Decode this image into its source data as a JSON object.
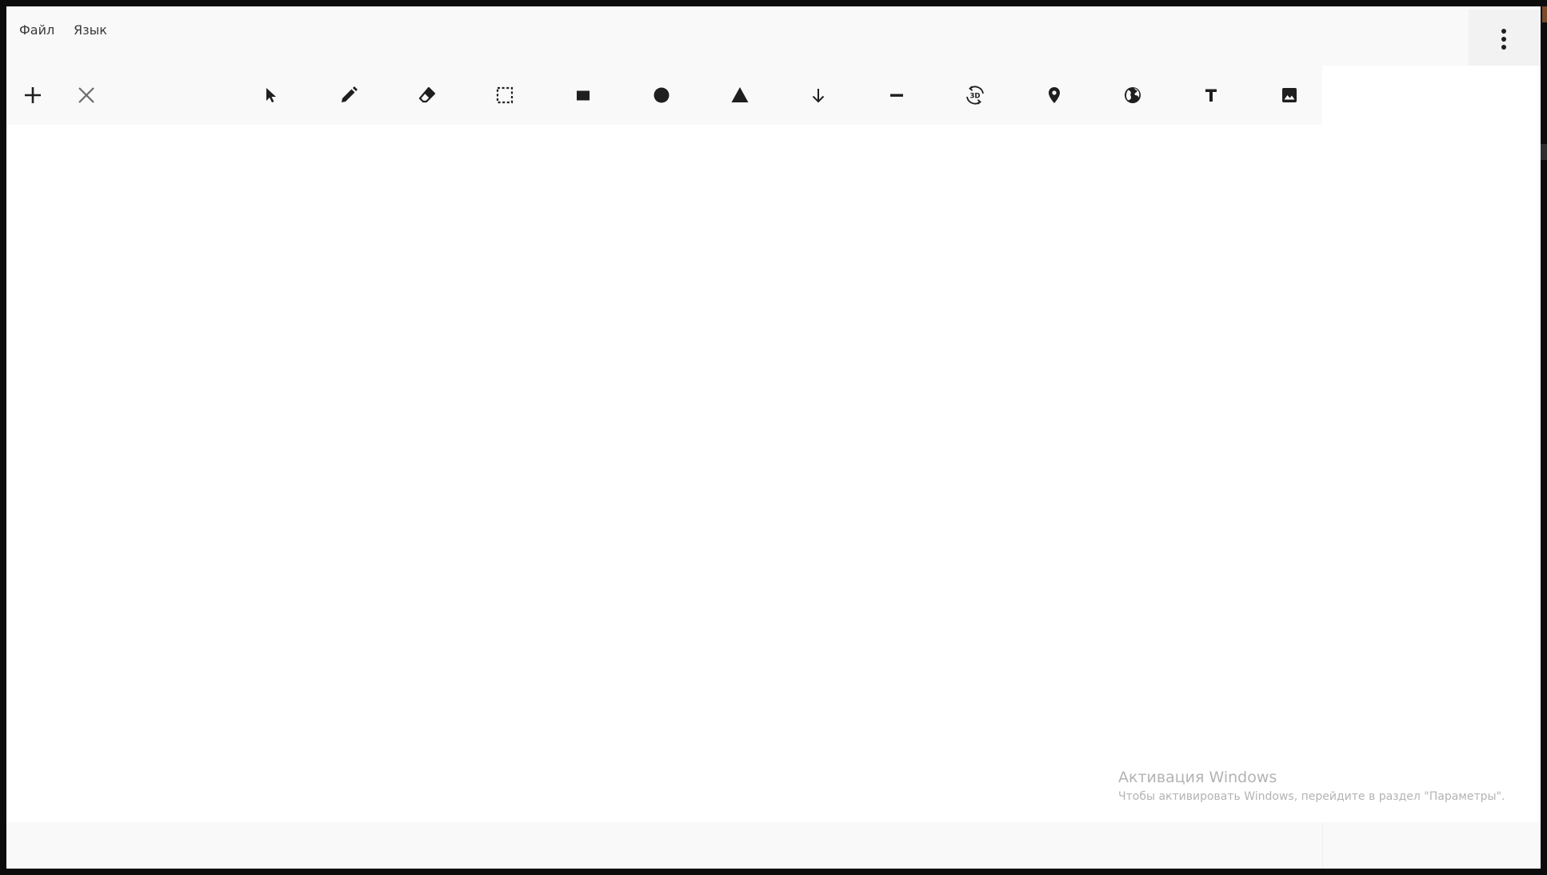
{
  "menubar": {
    "items": [
      {
        "label": "Файл"
      },
      {
        "label": "Язык"
      }
    ],
    "more_icon": "more-vertical-icon"
  },
  "toolbar": {
    "left_tools": [
      {
        "name": "add",
        "icon": "plus-icon"
      },
      {
        "name": "close",
        "icon": "close-icon"
      }
    ],
    "tools": [
      {
        "name": "select",
        "icon": "cursor-arrow-icon"
      },
      {
        "name": "pencil",
        "icon": "pencil-icon"
      },
      {
        "name": "eraser",
        "icon": "eraser-icon"
      },
      {
        "name": "selection-rect",
        "icon": "dashed-select-icon"
      },
      {
        "name": "rectangle",
        "icon": "rectangle-icon"
      },
      {
        "name": "circle",
        "icon": "circle-icon"
      },
      {
        "name": "triangle",
        "icon": "triangle-icon"
      },
      {
        "name": "arrow",
        "icon": "arrow-down-icon"
      },
      {
        "name": "line",
        "icon": "line-icon"
      },
      {
        "name": "rotate-3d",
        "icon": "rotate-3d-icon",
        "text": "3D"
      },
      {
        "name": "location",
        "icon": "map-pin-icon"
      },
      {
        "name": "globe",
        "icon": "globe-icon"
      },
      {
        "name": "text",
        "icon": "text-icon"
      },
      {
        "name": "image",
        "icon": "image-icon"
      }
    ]
  },
  "watermark": {
    "title": "Активация Windows",
    "subtitle": "Чтобы активировать Windows, перейдите в раздел \"Параметры\"."
  },
  "colors": {
    "icon": "#1f1f1f",
    "icon_muted": "#6b6b6b",
    "bar": "#f9f9f9",
    "canvas": "#ffffff",
    "watermark": "#b3b3b3"
  }
}
